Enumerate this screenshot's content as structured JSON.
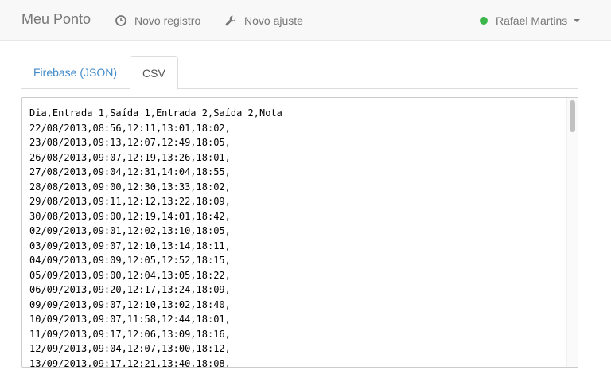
{
  "navbar": {
    "brand": "Meu Ponto",
    "links": [
      {
        "label": "Novo registro",
        "icon": "clock-icon"
      },
      {
        "label": "Novo ajuste",
        "icon": "wrench-icon"
      }
    ],
    "user": {
      "name": "Rafael Martins",
      "status_color": "#3cb54a"
    }
  },
  "tabs": [
    {
      "label": "Firebase (JSON)",
      "active": false
    },
    {
      "label": "CSV",
      "active": true
    }
  ],
  "csv": {
    "lines": [
      "Dia,Entrada 1,Saída 1,Entrada 2,Saída 2,Nota",
      "22/08/2013,08:56,12:11,13:01,18:02,",
      "23/08/2013,09:13,12:07,12:49,18:05,",
      "26/08/2013,09:07,12:19,13:26,18:01,",
      "27/08/2013,09:04,12:31,14:04,18:55,",
      "28/08/2013,09:00,12:30,13:33,18:02,",
      "29/08/2013,09:11,12:12,13:22,18:09,",
      "30/08/2013,09:00,12:19,14:01,18:42,",
      "02/09/2013,09:01,12:02,13:10,18:05,",
      "03/09/2013,09:07,12:10,13:14,18:11,",
      "04/09/2013,09:09,12:05,12:52,18:15,",
      "05/09/2013,09:00,12:04,13:05,18:22,",
      "06/09/2013,09:20,12:17,13:24,18:09,",
      "09/09/2013,09:07,12:10,13:02,18:40,",
      "10/09/2013,09:07,11:58,12:44,18:01,",
      "11/09/2013,09:17,12:06,13:09,18:16,",
      "12/09/2013,09:04,12:07,13:00,18:12,",
      "13/09/2013,09:17,12:21,13:40,18:08,"
    ]
  }
}
